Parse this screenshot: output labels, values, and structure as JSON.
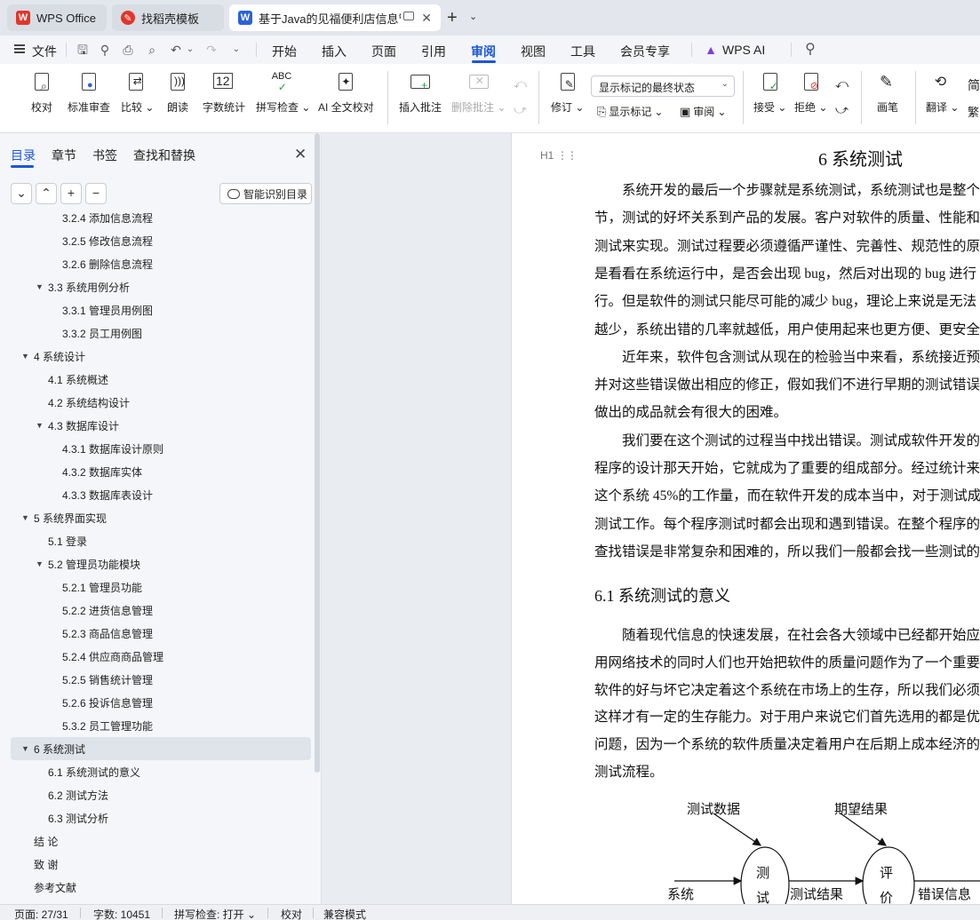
{
  "tabs": [
    {
      "label": "WPS Office"
    },
    {
      "label": "找稻壳模板"
    },
    {
      "label": "基于Java的见福便利店信息管"
    }
  ],
  "menu": {
    "file": "文件",
    "items": [
      "开始",
      "插入",
      "页面",
      "引用",
      "审阅",
      "视图",
      "工具",
      "会员专享"
    ],
    "active": "审阅",
    "wps_ai": "WPS AI"
  },
  "ribbon": {
    "proofread": "校对",
    "standard_review": "标准审查",
    "compare": "比较",
    "read_aloud": "朗读",
    "word_count": "字数统计",
    "spell_check": "拼写检查",
    "ai_proofread": "AI 全文校对",
    "insert_comment": "插入批注",
    "delete_comment": "删除批注",
    "track_changes": "修订",
    "markup_dropdown": "显示标记的最终状态",
    "show_markup": "显示标记",
    "review": "审阅",
    "accept": "接受",
    "reject": "拒绝",
    "pen": "画笔",
    "translate": "翻译",
    "simplified": "简",
    "traditional": "繁"
  },
  "leftpane": {
    "tabs": [
      "目录",
      "章节",
      "书签",
      "查找和替换"
    ],
    "smart_toc": "智能识别目录",
    "toc": [
      {
        "label": "3.2.4  添加信息流程",
        "level": 3,
        "expand": false
      },
      {
        "label": "3.2.5  修改信息流程",
        "level": 3,
        "expand": false
      },
      {
        "label": "3.2.6  删除信息流程",
        "level": 3,
        "expand": false
      },
      {
        "label": "3.3 系统用例分析",
        "level": 2,
        "expand": true
      },
      {
        "label": "3.3.1 管理员用例图",
        "level": 3,
        "expand": false
      },
      {
        "label": "3.3.2 员工用例图",
        "level": 3,
        "expand": false
      },
      {
        "label": "4  系统设计",
        "level": 1,
        "expand": true
      },
      {
        "label": "4.1  系统概述",
        "level": 2,
        "expand": false
      },
      {
        "label": "4.2  系统结构设计",
        "level": 2,
        "expand": false
      },
      {
        "label": "4.3 数据库设计",
        "level": 2,
        "expand": true
      },
      {
        "label": "4.3.1  数据库设计原则",
        "level": 3,
        "expand": false
      },
      {
        "label": "4.3.2  数据库实体",
        "level": 3,
        "expand": false
      },
      {
        "label": "4.3.3  数据库表设计",
        "level": 3,
        "expand": false
      },
      {
        "label": "5 系统界面实现",
        "level": 1,
        "expand": true
      },
      {
        "label": "5.1  登录",
        "level": 2,
        "expand": false
      },
      {
        "label": "5.2    管理员功能模块",
        "level": 2,
        "expand": true
      },
      {
        "label": "5.2.1  管理员功能",
        "level": 3,
        "expand": false
      },
      {
        "label": "5.2.2  进货信息管理",
        "level": 3,
        "expand": false
      },
      {
        "label": "5.2.3  商品信息管理",
        "level": 3,
        "expand": false
      },
      {
        "label": "5.2.4 供应商商品管理",
        "level": 3,
        "expand": false
      },
      {
        "label": "5.2.5 销售统计管理",
        "level": 3,
        "expand": false
      },
      {
        "label": "5.2.6 投诉信息管理",
        "level": 3,
        "expand": false
      },
      {
        "label": "5.3.2  员工管理功能",
        "level": 3,
        "expand": false
      },
      {
        "label": "6 系统测试",
        "level": 1,
        "expand": true,
        "selected": true
      },
      {
        "label": "6.1 系统测试的意义",
        "level": 2,
        "expand": false
      },
      {
        "label": "6.2  测试方法",
        "level": 2,
        "expand": false
      },
      {
        "label": "6.3 测试分析",
        "level": 2,
        "expand": false
      },
      {
        "label": "结      论",
        "level": 1,
        "expand": false
      },
      {
        "label": "致      谢",
        "level": 1,
        "expand": false
      },
      {
        "label": "参考文献",
        "level": 1,
        "expand": false
      }
    ]
  },
  "document": {
    "heading_marker": "H1",
    "chapter_title": "6 系统测试",
    "paragraphs": [
      "　　系统开发的最后一个步骤就是系统测试，系统测试也是整个",
      "节，测试的好坏关系到产品的发展。客户对软件的质量、性能和",
      "测试来实现。测试过程要必须遵循严谨性、完善性、规范性的原",
      "是看看在系统运行中，是否会出现 bug，然后对出现的 bug 进行",
      "行。但是软件的测试只能尽可能的减少 bug，理论上来说是无法",
      "越少，系统出错的几率就越低，用户使用起来也更方便、更安全",
      "　　近年来，软件包含测试从现在的检验当中来看，系统接近预",
      "并对这些错误做出相应的修正，假如我们不进行早期的测试错误",
      "做出的成品就会有很大的困难。",
      "　　我们要在这个测试的过程当中找出错误。测试成软件开发的",
      "程序的设计那天开始，它就成为了重要的组成部分。经过统计来",
      "这个系统 45%的工作量，而在软件开发的成本当中，对于测试成",
      "测试工作。每个程序测试时都会出现和遇到错误。在整个程序的",
      "查找错误是非常复杂和困难的，所以我们一般都会找一些测试的"
    ],
    "section_title": "6.1 系统测试的意义",
    "paragraphs2": [
      "　　随着现代信息的快速发展，在社会各大领域中已经都开始应",
      "用网络技术的同时人们也开始把软件的质量问题作为了一个重要",
      "软件的好与坏它决定着这个系统在市场上的生存，所以我们必须",
      "这样才有一定的生存能力。对于用户来说它们首先选用的都是优",
      "问题，因为一个系统的软件质量决定着用户在后期上成本经济的",
      "测试流程。"
    ],
    "diagram": {
      "test_data": "测试数据",
      "expected_result": "期望结果",
      "system": "系统",
      "test_node": "测试",
      "test_result": "测试结果",
      "eval_node": "评价",
      "error_info": "错误信息"
    }
  },
  "statusbar": {
    "page": "页面: 27/31",
    "words": "字数: 10451",
    "spell": "拼写检查: 打开",
    "proof": "校对",
    "compat": "兼容模式"
  }
}
